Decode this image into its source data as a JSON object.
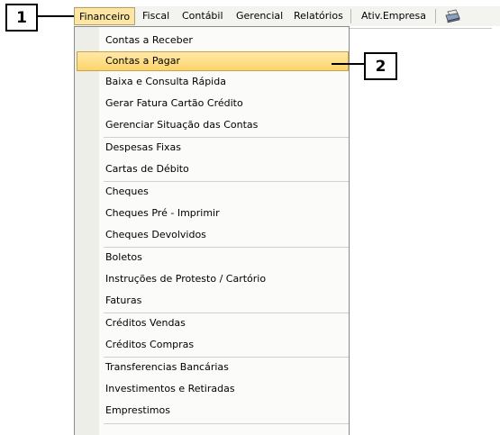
{
  "callouts": {
    "one": "1",
    "two": "2"
  },
  "menubar": {
    "items": [
      "Financeiro",
      "Fiscal",
      "Contábil",
      "Gerencial",
      "Relatórios",
      "Ativ.Empresa"
    ],
    "active": "Financeiro",
    "icon": "printer-icon"
  },
  "dropdown": {
    "highlighted": "Contas a Pagar",
    "items": [
      "Contas a Receber",
      "Contas a Pagar",
      "Baixa e Consulta Rápida",
      "Gerar Fatura Cartão Crédito",
      "Gerenciar Situação das Contas",
      "Despesas Fixas",
      "Cartas de Débito",
      "Cheques",
      "Cheques Pré - Imprimir",
      "Cheques Devolvidos",
      "Boletos",
      "Instruções de Protesto / Cartório",
      "Faturas",
      "Créditos Vendas",
      "Créditos Compras",
      "Transferencias Bancárias",
      "Investimentos e Retiradas",
      "Emprestimos"
    ]
  },
  "colors": {
    "highlight": "#fdd46a",
    "menubar": "#f3f3ef",
    "border": "#8a8a8a"
  }
}
